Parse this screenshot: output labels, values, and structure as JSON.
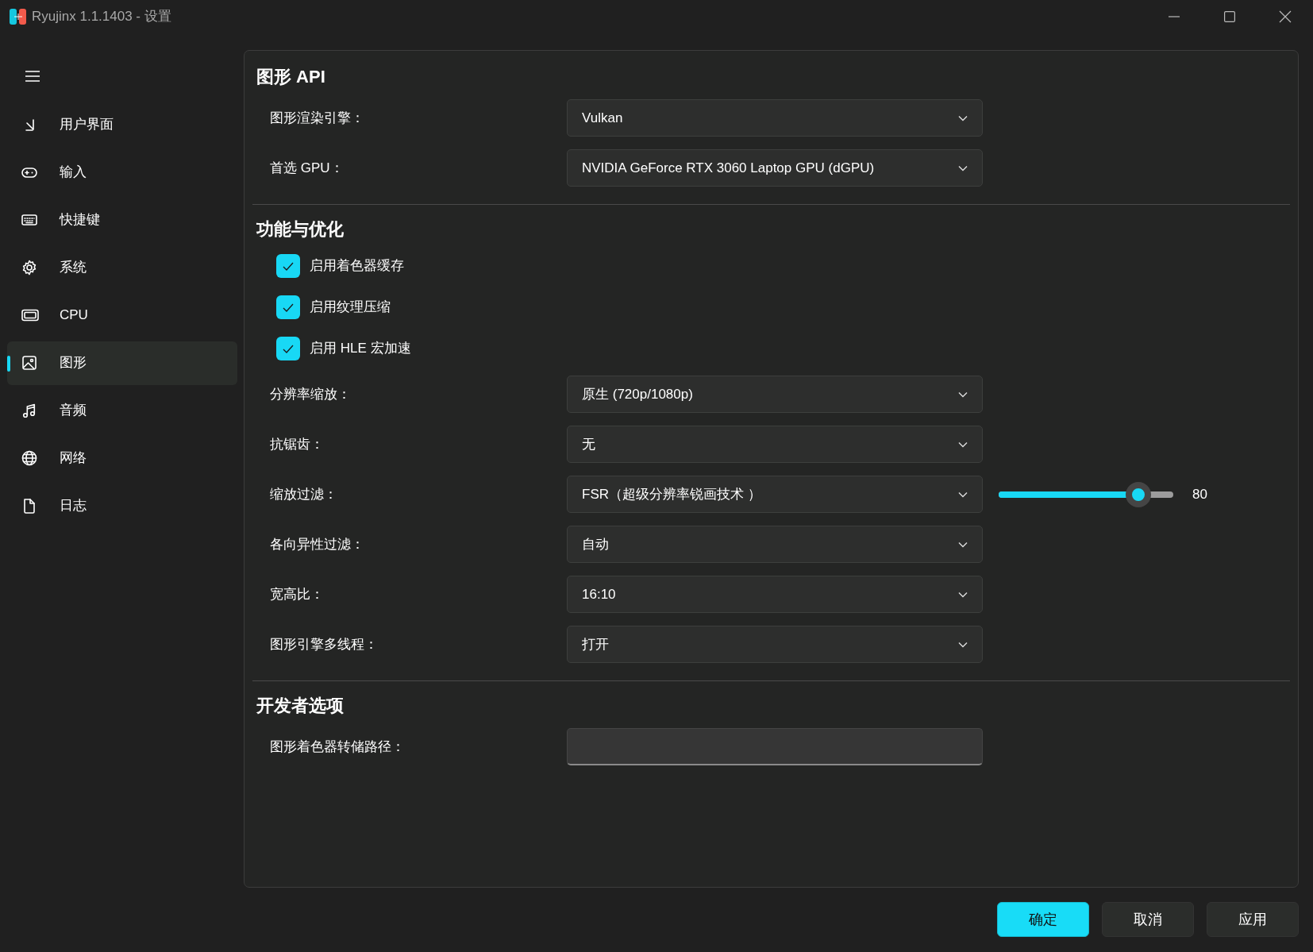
{
  "window": {
    "title": "Ryujinx 1.1.1403 - 设置"
  },
  "sidebar": {
    "items": [
      {
        "label": "用户界面",
        "selected": false
      },
      {
        "label": "输入",
        "selected": false
      },
      {
        "label": "快捷键",
        "selected": false
      },
      {
        "label": "系统",
        "selected": false
      },
      {
        "label": "CPU",
        "selected": false
      },
      {
        "label": "图形",
        "selected": true
      },
      {
        "label": "音频",
        "selected": false
      },
      {
        "label": "网络",
        "selected": false
      },
      {
        "label": "日志",
        "selected": false
      }
    ]
  },
  "sections": [
    {
      "title": "图形 API",
      "rows": [
        {
          "kind": "dropdown",
          "label": "图形渲染引擎：",
          "value": "Vulkan"
        },
        {
          "kind": "dropdown",
          "label": "首选 GPU：",
          "value": "NVIDIA GeForce RTX 3060 Laptop GPU (dGPU)"
        }
      ]
    },
    {
      "title": "功能与优化",
      "rows": [
        {
          "kind": "checkbox",
          "label": "启用着色器缓存",
          "checked": true
        },
        {
          "kind": "checkbox",
          "label": "启用纹理压缩",
          "checked": true
        },
        {
          "kind": "checkbox",
          "label": "启用 HLE 宏加速",
          "checked": true
        },
        {
          "kind": "dropdown",
          "label": "分辨率缩放：",
          "value": "原生 (720p/1080p)"
        },
        {
          "kind": "dropdown",
          "label": "抗锯齿：",
          "value": "无"
        },
        {
          "kind": "dropdown",
          "label": "缩放过滤：",
          "value": "FSR（超级分辨率锐画技术 ）",
          "slider": {
            "level": 0.8,
            "reading": "80"
          }
        },
        {
          "kind": "dropdown",
          "label": "各向异性过滤：",
          "value": "自动"
        },
        {
          "kind": "dropdown",
          "label": "宽高比：",
          "value": "16:10"
        },
        {
          "kind": "dropdown",
          "label": "图形引擎多线程：",
          "value": "打开"
        }
      ]
    },
    {
      "title": "开发者选项",
      "rows": [
        {
          "kind": "text",
          "label": "图形着色器转储路径："
        }
      ]
    }
  ],
  "buttons": [
    {
      "label": "确定",
      "primary": true
    },
    {
      "label": "取消",
      "primary": false
    },
    {
      "label": "应用",
      "primary": false
    }
  ]
}
